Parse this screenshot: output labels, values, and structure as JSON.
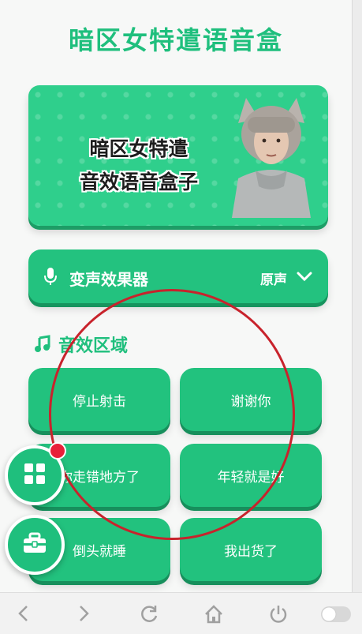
{
  "app": {
    "title": "暗区女特遣语音盒"
  },
  "banner": {
    "line1": "暗区女特遣",
    "line2": "音效语音盒子"
  },
  "voice_changer": {
    "label": "变声效果器",
    "value": "原声",
    "icon": "microphone-icon",
    "dropdown_icon": "chevron-down-icon"
  },
  "section": {
    "title": "音效区域",
    "icon": "music-note-icon"
  },
  "sounds": [
    {
      "label": "停止射击"
    },
    {
      "label": "谢谢你"
    },
    {
      "label": "你走错地方了"
    },
    {
      "label": "年轻就是好"
    },
    {
      "label": "倒头就睡"
    },
    {
      "label": "我出货了"
    }
  ],
  "fabs": [
    {
      "icon": "grid-icon"
    },
    {
      "icon": "toolbox-icon"
    }
  ],
  "colors": {
    "accent": "#1fbf7d",
    "annotation": "#c8232c",
    "badge": "#e8203a"
  },
  "navbar": [
    "back-icon",
    "forward-icon",
    "refresh-icon",
    "home-icon",
    "power-icon",
    "toggle-icon"
  ]
}
